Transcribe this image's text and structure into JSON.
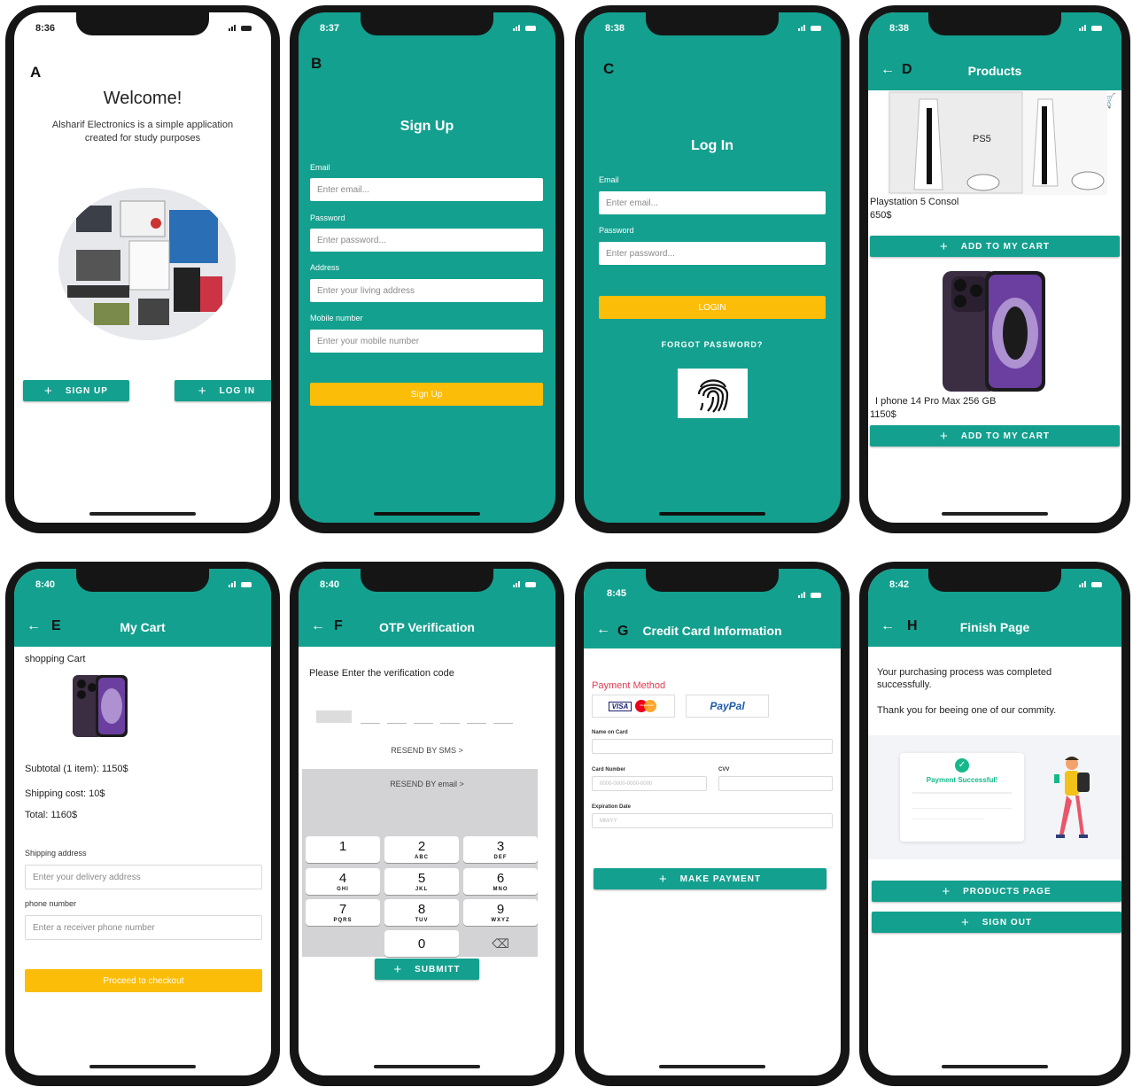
{
  "phones": {
    "a": {
      "letter": "A",
      "time": "8:36",
      "title": "Welcome!",
      "description": "Alsharif Electronics is a simple application created for study purposes",
      "signup_label": "SIGN UP",
      "login_label": "LOG IN"
    },
    "b": {
      "letter": "B",
      "time": "8:37",
      "title": "Sign Up",
      "fields": [
        {
          "label": "Email",
          "placeholder": "Enter email..."
        },
        {
          "label": "Password",
          "placeholder": "Enter password..."
        },
        {
          "label": "Address",
          "placeholder": "Enter your living address"
        },
        {
          "label": "Mobile number",
          "placeholder": "Enter your mobile number"
        }
      ],
      "submit_label": "Sign Up"
    },
    "c": {
      "letter": "C",
      "time": "8:38",
      "title": "Log In",
      "fields": [
        {
          "label": "Email",
          "placeholder": "Enter email..."
        },
        {
          "label": "Password",
          "placeholder": "Enter password..."
        }
      ],
      "login_label": "LOGIN",
      "forgot_label": "FORGOT PASSWORD?"
    },
    "d": {
      "letter": "D",
      "time": "8:38",
      "title": "Products",
      "products": [
        {
          "name": "Playstation 5 Consol",
          "price": "650$",
          "button": "ADD TO MY CART"
        },
        {
          "name": "I phone 14 Pro Max 256 GB",
          "price": "1150$",
          "button": "ADD TO MY CART"
        }
      ]
    },
    "e": {
      "letter": "E",
      "time": "8:40",
      "title": "My Cart",
      "section": "shopping Cart",
      "subtotal": "Subtotal (1 item): 1150$",
      "shipping": "Shipping cost: 10$",
      "total": "Total: 1160$",
      "address_label": "Shipping address",
      "address_placeholder": "Enter your delivery address",
      "phone_label": "phone number",
      "phone_placeholder": "Enter a receiver phone number",
      "checkout_label": "Proceed to checkout"
    },
    "f": {
      "letter": "F",
      "time": "8:40",
      "title": "OTP Verification",
      "instruction": "Please Enter the verification code",
      "resend_sms": "RESEND BY SMS >",
      "resend_email": "RESEND BY email >",
      "keys": [
        {
          "n": "1",
          "l": ""
        },
        {
          "n": "2",
          "l": "ABC"
        },
        {
          "n": "3",
          "l": "DEF"
        },
        {
          "n": "4",
          "l": "GHI"
        },
        {
          "n": "5",
          "l": "JKL"
        },
        {
          "n": "6",
          "l": "MNO"
        },
        {
          "n": "7",
          "l": "PQRS"
        },
        {
          "n": "8",
          "l": "TUV"
        },
        {
          "n": "9",
          "l": "WXYZ"
        },
        {
          "n": "0",
          "l": ""
        }
      ],
      "submit_label": "SUBMITT"
    },
    "g": {
      "letter": "G",
      "time": "8:45",
      "title": "Credit Card Information",
      "payment_method": "Payment Method",
      "visa": "VISA",
      "mastercard": "MasterCard",
      "paypal": "PayPal",
      "name_label": "Name on Card",
      "card_label": "Card Number",
      "card_placeholder": "0000-0000-0000-0000",
      "cvv_label": "CVV",
      "exp_label": "Expiration Date",
      "exp_placeholder": "MM/YY",
      "pay_label": "MAKE PAYMENT"
    },
    "h": {
      "letter": "H",
      "time": "8:42",
      "title": "Finish Page",
      "message1": "Your purchasing process was completed successfully.",
      "message2": "Thank you for beeing one of our commity.",
      "success_label": "Payment Successful!",
      "products_label": "PRODUCTS PAGE",
      "signout_label": "SIGN OUT"
    }
  },
  "colors": {
    "teal": "#14a08f",
    "yellow": "#fbbd08",
    "payment_red": "#e53950"
  }
}
